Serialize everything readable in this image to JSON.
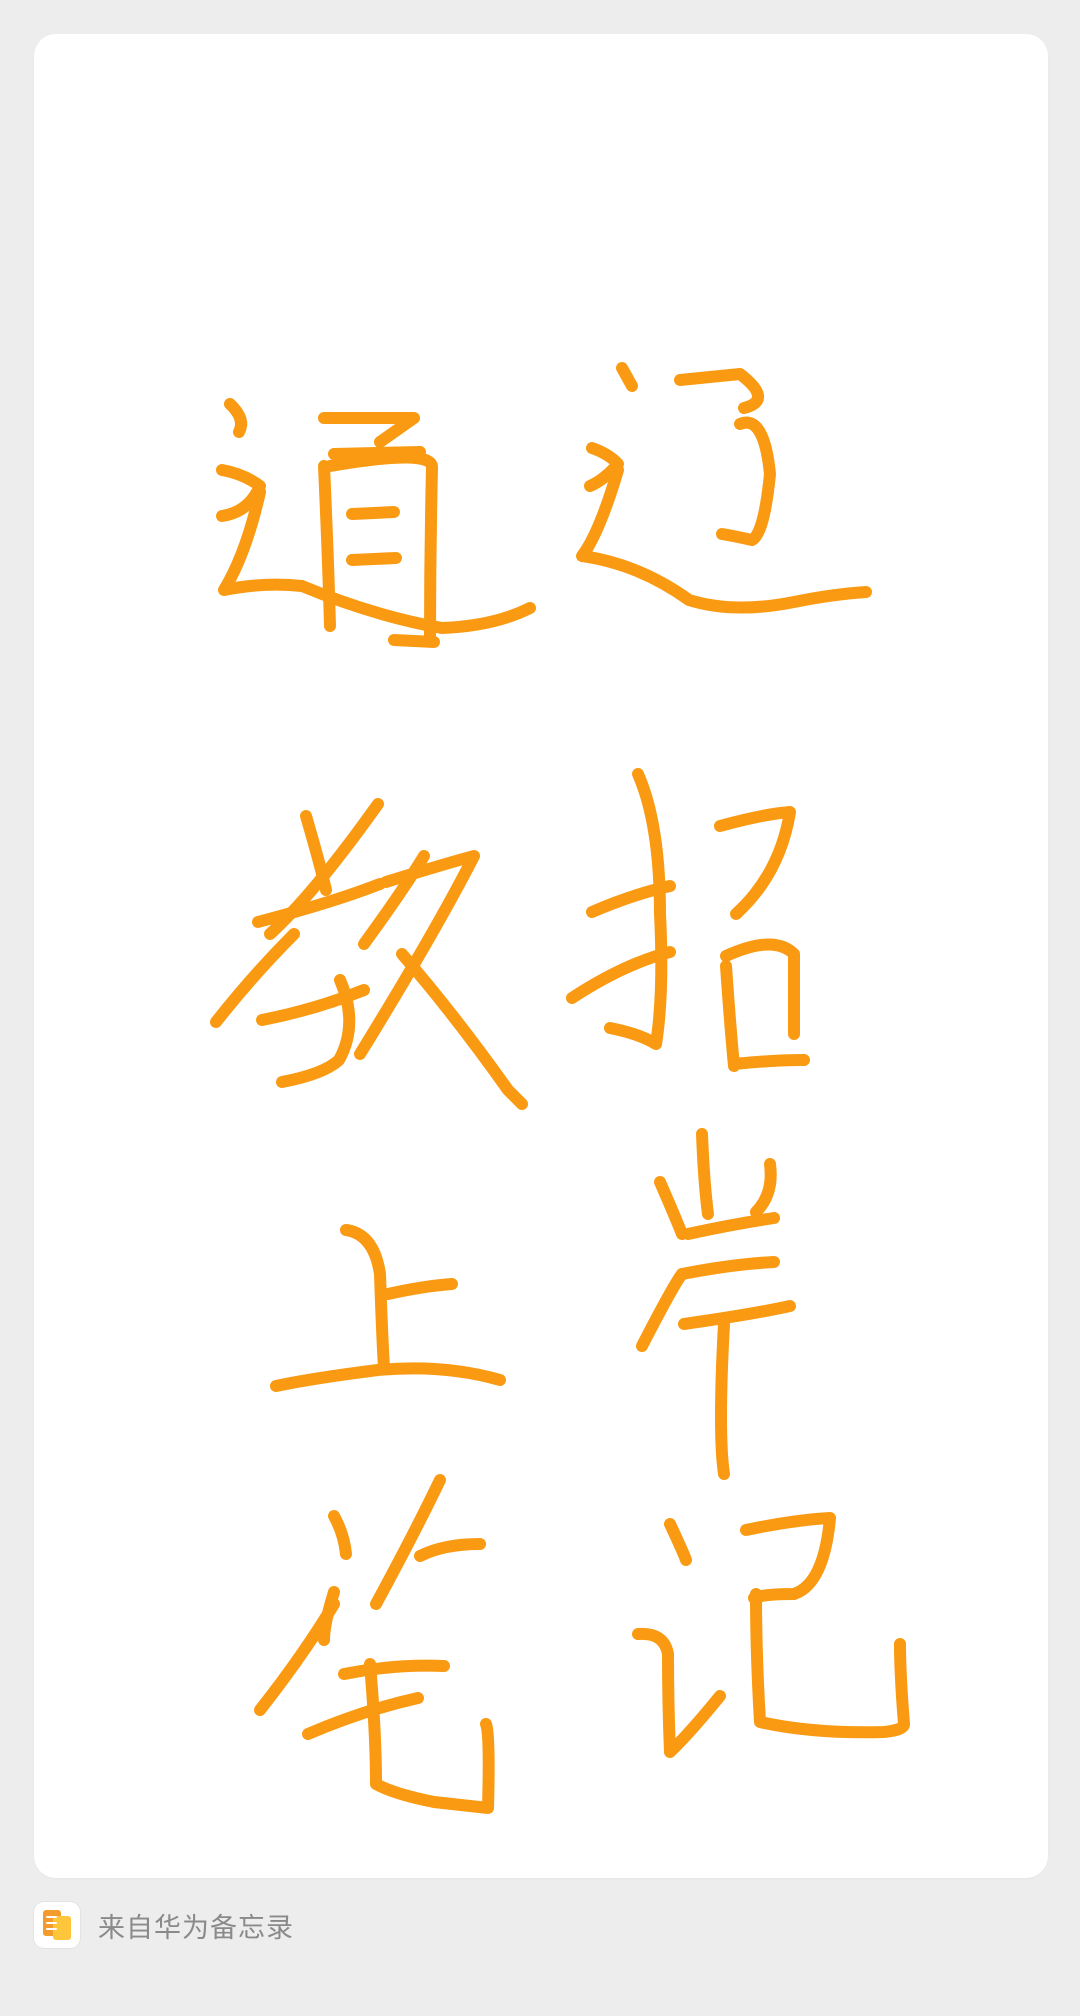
{
  "note": {
    "handwritten_text": [
      "通过",
      "教招",
      "上岸",
      "笔记"
    ],
    "ink_color": "#F99A12"
  },
  "footer": {
    "source_label": "来自华为备忘录",
    "app_icon": "huawei-notes-icon"
  },
  "colors": {
    "background": "#EDEDED",
    "card": "#FFFFFF",
    "footer_text": "#8A8A8A"
  }
}
